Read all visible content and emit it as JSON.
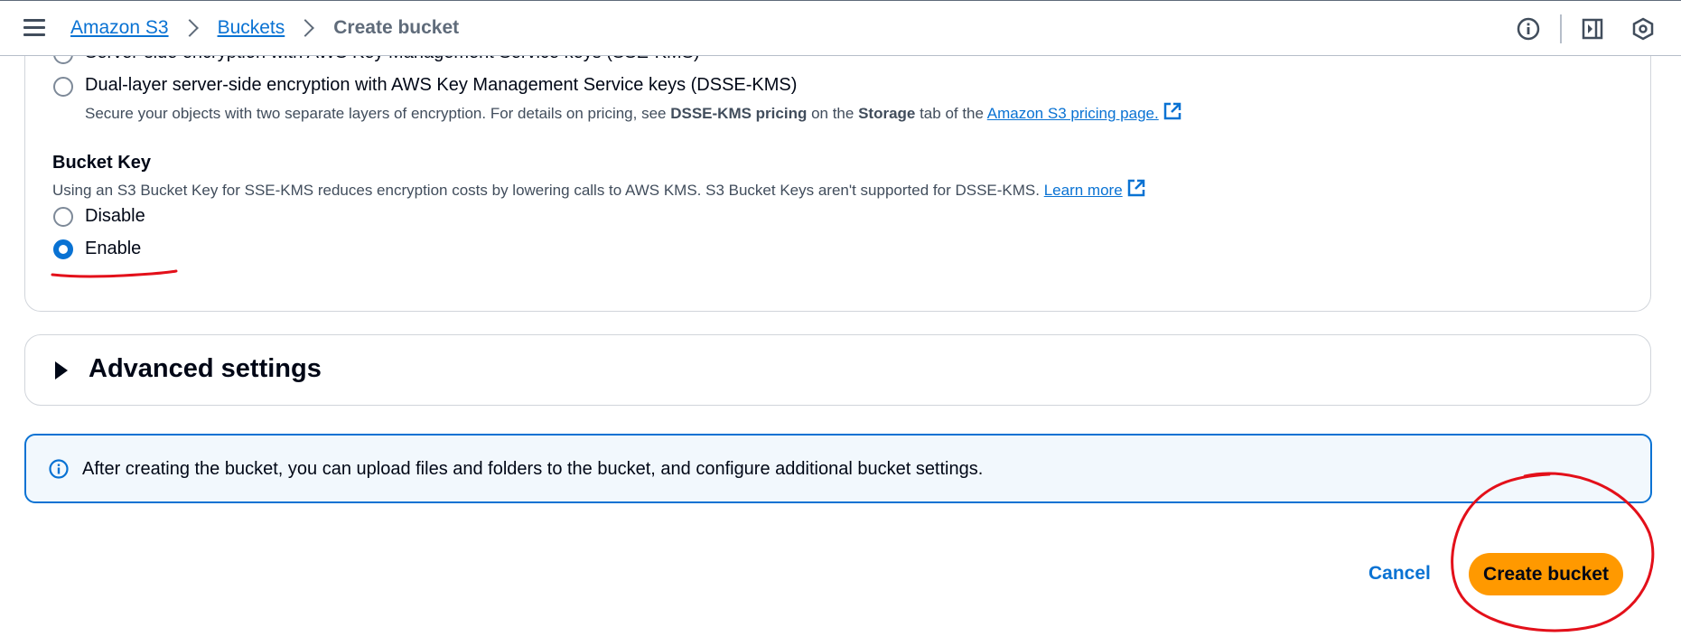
{
  "breadcrumb": {
    "items": [
      "Amazon S3",
      "Buckets"
    ],
    "current": "Create bucket"
  },
  "encryption": {
    "sse_kms_label": "Server-side encryption with AWS Key Management Service keys (SSE-KMS)",
    "dsse_label": "Dual-layer server-side encryption with AWS Key Management Service keys (DSSE-KMS)",
    "dsse_desc_prefix": "Secure your objects with two separate layers of encryption. For details on pricing, see ",
    "dsse_desc_bold1": "DSSE-KMS pricing",
    "dsse_desc_mid": " on the ",
    "dsse_desc_bold2": "Storage",
    "dsse_desc_suffix": " tab of the ",
    "dsse_desc_link": "Amazon S3 pricing page."
  },
  "bucket_key": {
    "title": "Bucket Key",
    "description": "Using an S3 Bucket Key for SSE-KMS reduces encryption costs by lowering calls to AWS KMS. S3 Bucket Keys aren't supported for DSSE-KMS.",
    "learn_more": "Learn more",
    "options": [
      "Disable",
      "Enable"
    ],
    "selected": "Enable"
  },
  "advanced": {
    "title": "Advanced settings"
  },
  "alert": {
    "text": "After creating the bucket, you can upload files and folders to the bucket, and configure additional bucket settings."
  },
  "footer": {
    "cancel_label": "Cancel",
    "create_label": "Create bucket"
  },
  "colors": {
    "link": "#0972d3",
    "primary_button": "#ff9900",
    "alert_bg": "#f2f8fd",
    "annotation": "#e3101a"
  },
  "icons": {
    "menu": "hamburger-icon",
    "info": "info-icon",
    "external": "external-link-icon",
    "top_right": [
      "info-icon",
      "notifications-panel-icon",
      "settings-hexagon-icon"
    ]
  }
}
